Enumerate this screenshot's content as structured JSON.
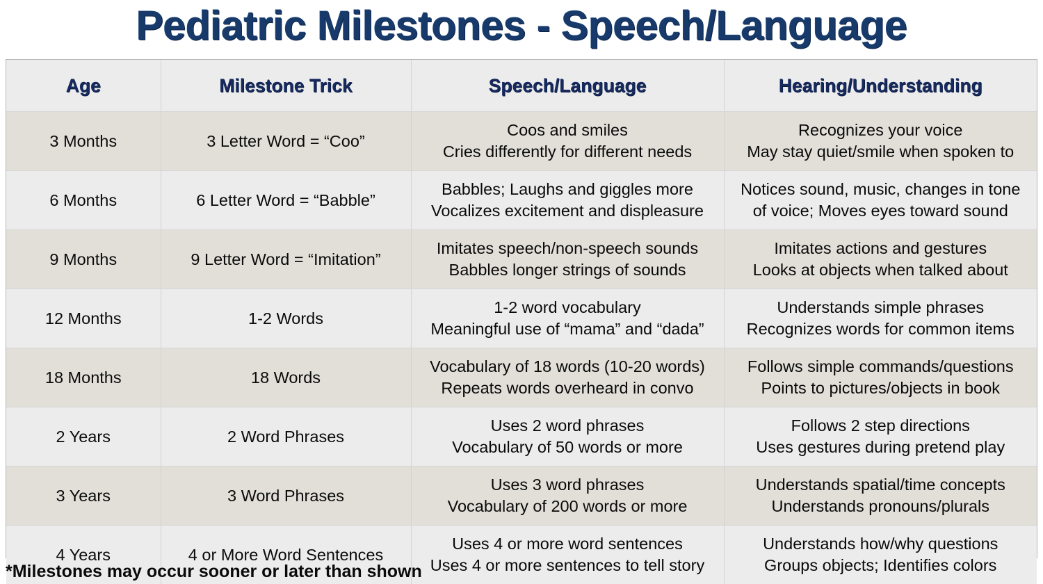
{
  "title": "Pediatric Milestones - Speech/Language",
  "footnote": "*Milestones may occur sooner or later than shown",
  "colors": {
    "title_navy": "#173a6b",
    "header_navy": "#172a5e",
    "row_beige": "#e1dfd8",
    "row_gray": "#ececec",
    "grid_line": "#d3d3d3",
    "table_border": "#b5b5b5",
    "body_text": "#0a0a0a"
  },
  "table": {
    "columns": [
      {
        "key": "age",
        "label": "Age"
      },
      {
        "key": "trick",
        "label": "Milestone Trick"
      },
      {
        "key": "speech",
        "label": "Speech/Language"
      },
      {
        "key": "hearing",
        "label": "Hearing/Understanding"
      }
    ],
    "rows": [
      {
        "age": "3 Months",
        "trick": "3 Letter Word = “Coo”",
        "speech_line1": "Coos and smiles",
        "speech_line2": "Cries differently for different needs",
        "hearing_line1": "Recognizes your voice",
        "hearing_line2": "May stay quiet/smile when spoken to"
      },
      {
        "age": "6 Months",
        "trick": "6 Letter Word = “Babble”",
        "speech_line1": "Babbles; Laughs and giggles more",
        "speech_line2": "Vocalizes excitement and displeasure",
        "hearing_line1": "Notices sound, music, changes in tone",
        "hearing_line2": "of voice; Moves eyes toward sound"
      },
      {
        "age": "9 Months",
        "trick": "9 Letter Word = “Imitation”",
        "speech_line1": "Imitates speech/non-speech sounds",
        "speech_line2": "Babbles longer strings of sounds",
        "hearing_line1": "Imitates actions and gestures",
        "hearing_line2": "Looks at objects when talked about"
      },
      {
        "age": "12 Months",
        "trick": "1-2 Words",
        "speech_line1": "1-2 word vocabulary",
        "speech_line2": "Meaningful use of “mama” and “dada”",
        "hearing_line1": "Understands simple phrases",
        "hearing_line2": "Recognizes words for common items"
      },
      {
        "age": "18 Months",
        "trick": "18 Words",
        "speech_line1": "Vocabulary of 18 words (10-20 words)",
        "speech_line2": "Repeats words overheard in convo",
        "hearing_line1": "Follows simple commands/questions",
        "hearing_line2": "Points to pictures/objects in book"
      },
      {
        "age": "2 Years",
        "trick": "2 Word Phrases",
        "speech_line1": "Uses 2 word phrases",
        "speech_line2": "Vocabulary of 50 words or more",
        "hearing_line1": "Follows 2 step directions",
        "hearing_line2": "Uses gestures during pretend play"
      },
      {
        "age": "3 Years",
        "trick": "3 Word Phrases",
        "speech_line1": "Uses 3 word phrases",
        "speech_line2": "Vocabulary of 200 words or more",
        "hearing_line1": "Understands spatial/time concepts",
        "hearing_line2": "Understands pronouns/plurals"
      },
      {
        "age": "4 Years",
        "trick": "4 or More Word Sentences",
        "speech_line1": "Uses 4 or more word sentences",
        "speech_line2": "Uses 4 or more sentences to tell story",
        "hearing_line1": "Understands how/why questions",
        "hearing_line2": "Groups objects; Identifies colors"
      }
    ]
  }
}
